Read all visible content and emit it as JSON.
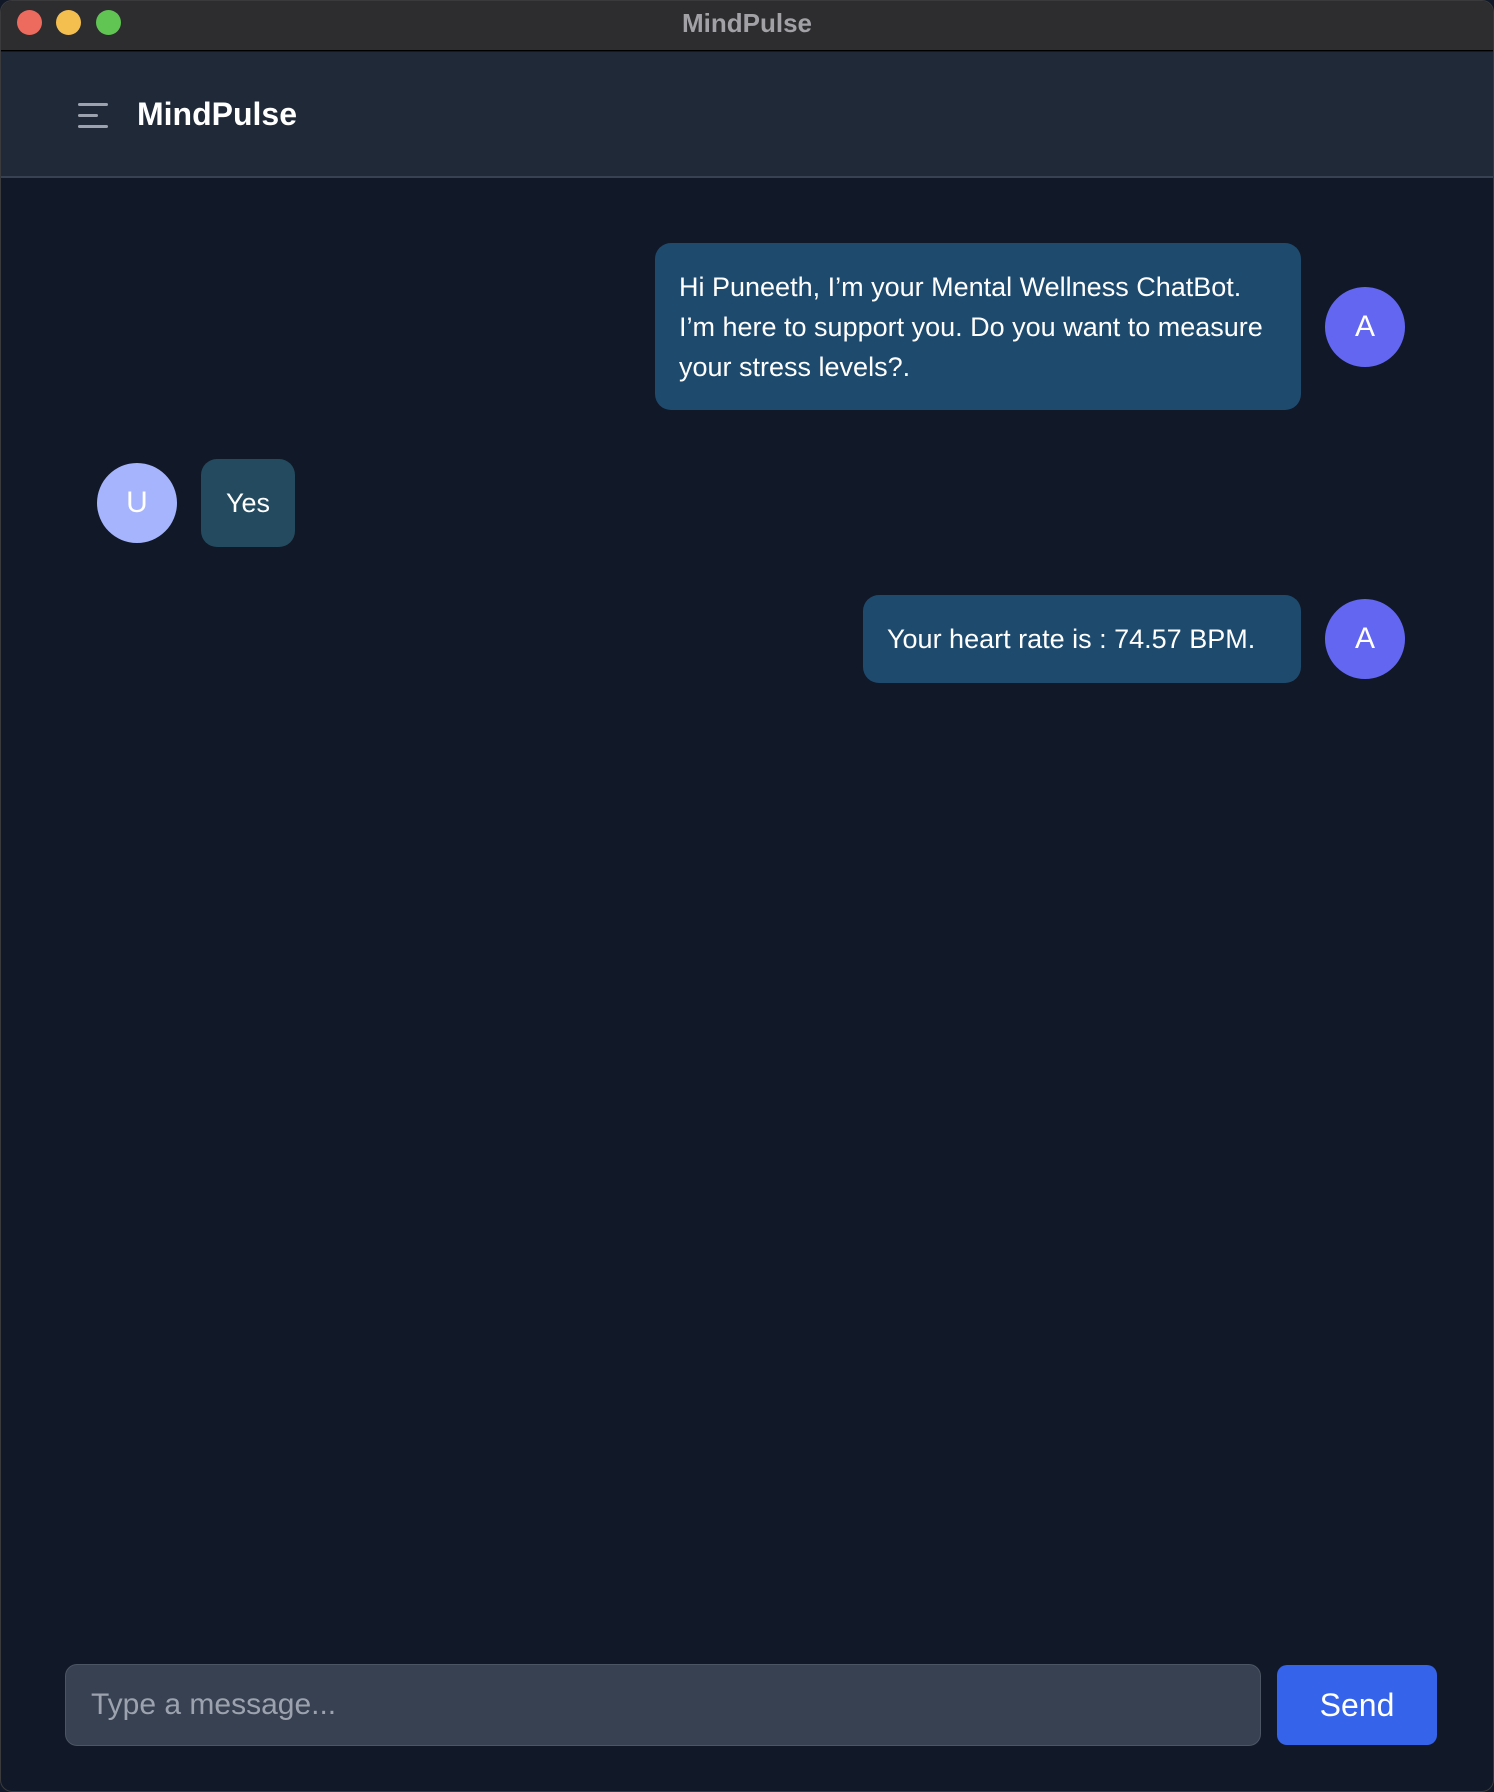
{
  "window": {
    "title": "MindPulse"
  },
  "header": {
    "title": "MindPulse",
    "menu_icon": "hamburger-menu-icon"
  },
  "messages": [
    {
      "sender": "bot",
      "avatar_label": "A",
      "text": "Hi Puneeth, I’m your Mental Wellness ChatBot. I’m here to support you. Do you want to measure your stress levels?."
    },
    {
      "sender": "user",
      "avatar_label": "U",
      "text": "Yes"
    },
    {
      "sender": "bot",
      "avatar_label": "A",
      "text": "Your heart rate is : 74.57 BPM."
    }
  ],
  "composer": {
    "placeholder": "Type a message...",
    "value": "",
    "send_label": "Send"
  },
  "colors": {
    "background": "#111827",
    "header": "#1f2937",
    "bot_bubble": "#1e4a6e",
    "user_bubble": "#234a5e",
    "bot_avatar": "#6366f1",
    "user_avatar": "#a5b4fc",
    "send_button": "#3563e9"
  }
}
